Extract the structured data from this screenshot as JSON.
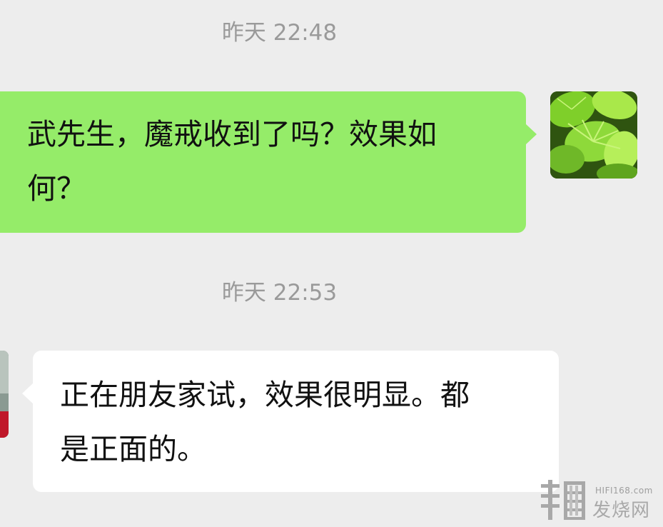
{
  "messages": [
    {
      "timestamp": "昨天 22:48",
      "direction": "sent",
      "line1": "武先生，魔戒收到了吗？效果如",
      "line2": "何？"
    },
    {
      "timestamp": "昨天 22:53",
      "direction": "received",
      "line1": "正在朋友家试，效果很明显。都",
      "line2": "是正面的。"
    }
  ],
  "watermark": {
    "domain": "HIFI168.com",
    "name": "发烧网"
  },
  "colors": {
    "background": "#ededed",
    "sent_bubble": "#95ec69",
    "received_bubble": "#ffffff",
    "timestamp_text": "#9a9a9a"
  }
}
